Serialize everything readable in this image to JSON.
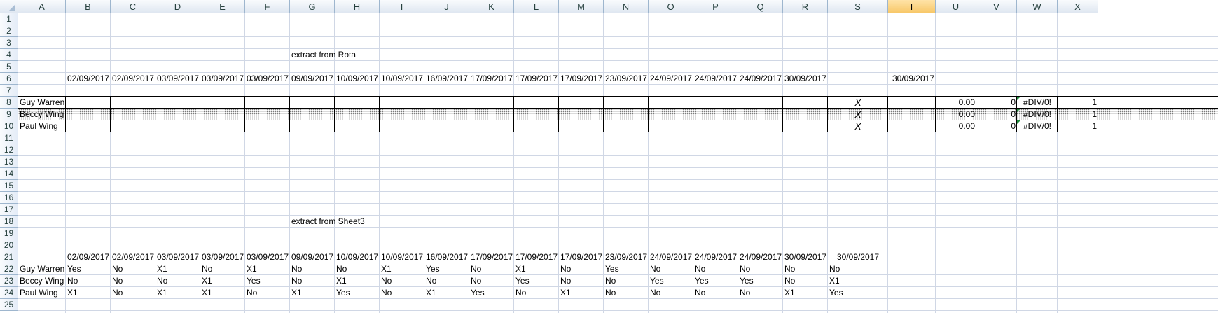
{
  "spreadsheet": {
    "columns": [
      "A",
      "B",
      "C",
      "D",
      "E",
      "F",
      "G",
      "H",
      "I",
      "J",
      "K",
      "L",
      "M",
      "N",
      "O",
      "P",
      "Q",
      "R",
      "S",
      "T",
      "U",
      "V",
      "W",
      "X"
    ],
    "selected_column": "T",
    "rows": [
      "1",
      "2",
      "3",
      "4",
      "5",
      "6",
      "7",
      "8",
      "9",
      "10",
      "11",
      "12",
      "13",
      "14",
      "15",
      "16",
      "17",
      "18",
      "19",
      "20",
      "21",
      "22",
      "23",
      "24",
      "25"
    ]
  },
  "rota": {
    "title": "extract from Rota",
    "dates": [
      "02/09/2017",
      "02/09/2017",
      "03/09/2017",
      "03/09/2017",
      "03/09/2017",
      "09/09/2017",
      "10/09/2017",
      "10/09/2017",
      "16/09/2017",
      "17/09/2017",
      "17/09/2017",
      "17/09/2017",
      "23/09/2017",
      "24/09/2017",
      "24/09/2017",
      "24/09/2017",
      "30/09/2017"
    ],
    "date_T": "30/09/2017",
    "people": [
      {
        "name": "Guy Warren",
        "mark": "X",
        "u": "0.00",
        "v": "0",
        "w": "#DIV/0!",
        "x": "1"
      },
      {
        "name": "Beccy Wing",
        "mark": "X",
        "u": "0.00",
        "v": "0",
        "w": "#DIV/0!",
        "x": "1"
      },
      {
        "name": "Paul Wing",
        "mark": "X",
        "u": "0.00",
        "v": "0",
        "w": "#DIV/0!",
        "x": "1"
      }
    ]
  },
  "sheet3": {
    "title": "extract from Sheet3",
    "dates": [
      "02/09/2017",
      "02/09/2017",
      "03/09/2017",
      "03/09/2017",
      "03/09/2017",
      "09/09/2017",
      "10/09/2017",
      "10/09/2017",
      "16/09/2017",
      "17/09/2017",
      "17/09/2017",
      "17/09/2017",
      "23/09/2017",
      "24/09/2017",
      "24/09/2017",
      "24/09/2017",
      "30/09/2017",
      "30/09/2017"
    ],
    "people": [
      {
        "name": "Guy Warren",
        "values": [
          "Yes",
          "No",
          "X1",
          "No",
          "X1",
          "No",
          "No",
          "X1",
          "Yes",
          "No",
          "X1",
          "No",
          "Yes",
          "No",
          "No",
          "No",
          "No",
          "No"
        ]
      },
      {
        "name": "Beccy Wing",
        "values": [
          "No",
          "No",
          "No",
          "X1",
          "Yes",
          "No",
          "X1",
          "No",
          "No",
          "No",
          "Yes",
          "No",
          "No",
          "Yes",
          "Yes",
          "Yes",
          "No",
          "X1"
        ]
      },
      {
        "name": "Paul Wing",
        "values": [
          "X1",
          "No",
          "X1",
          "X1",
          "No",
          "X1",
          "Yes",
          "No",
          "X1",
          "Yes",
          "No",
          "X1",
          "No",
          "No",
          "No",
          "No",
          "X1",
          "Yes"
        ]
      }
    ]
  }
}
